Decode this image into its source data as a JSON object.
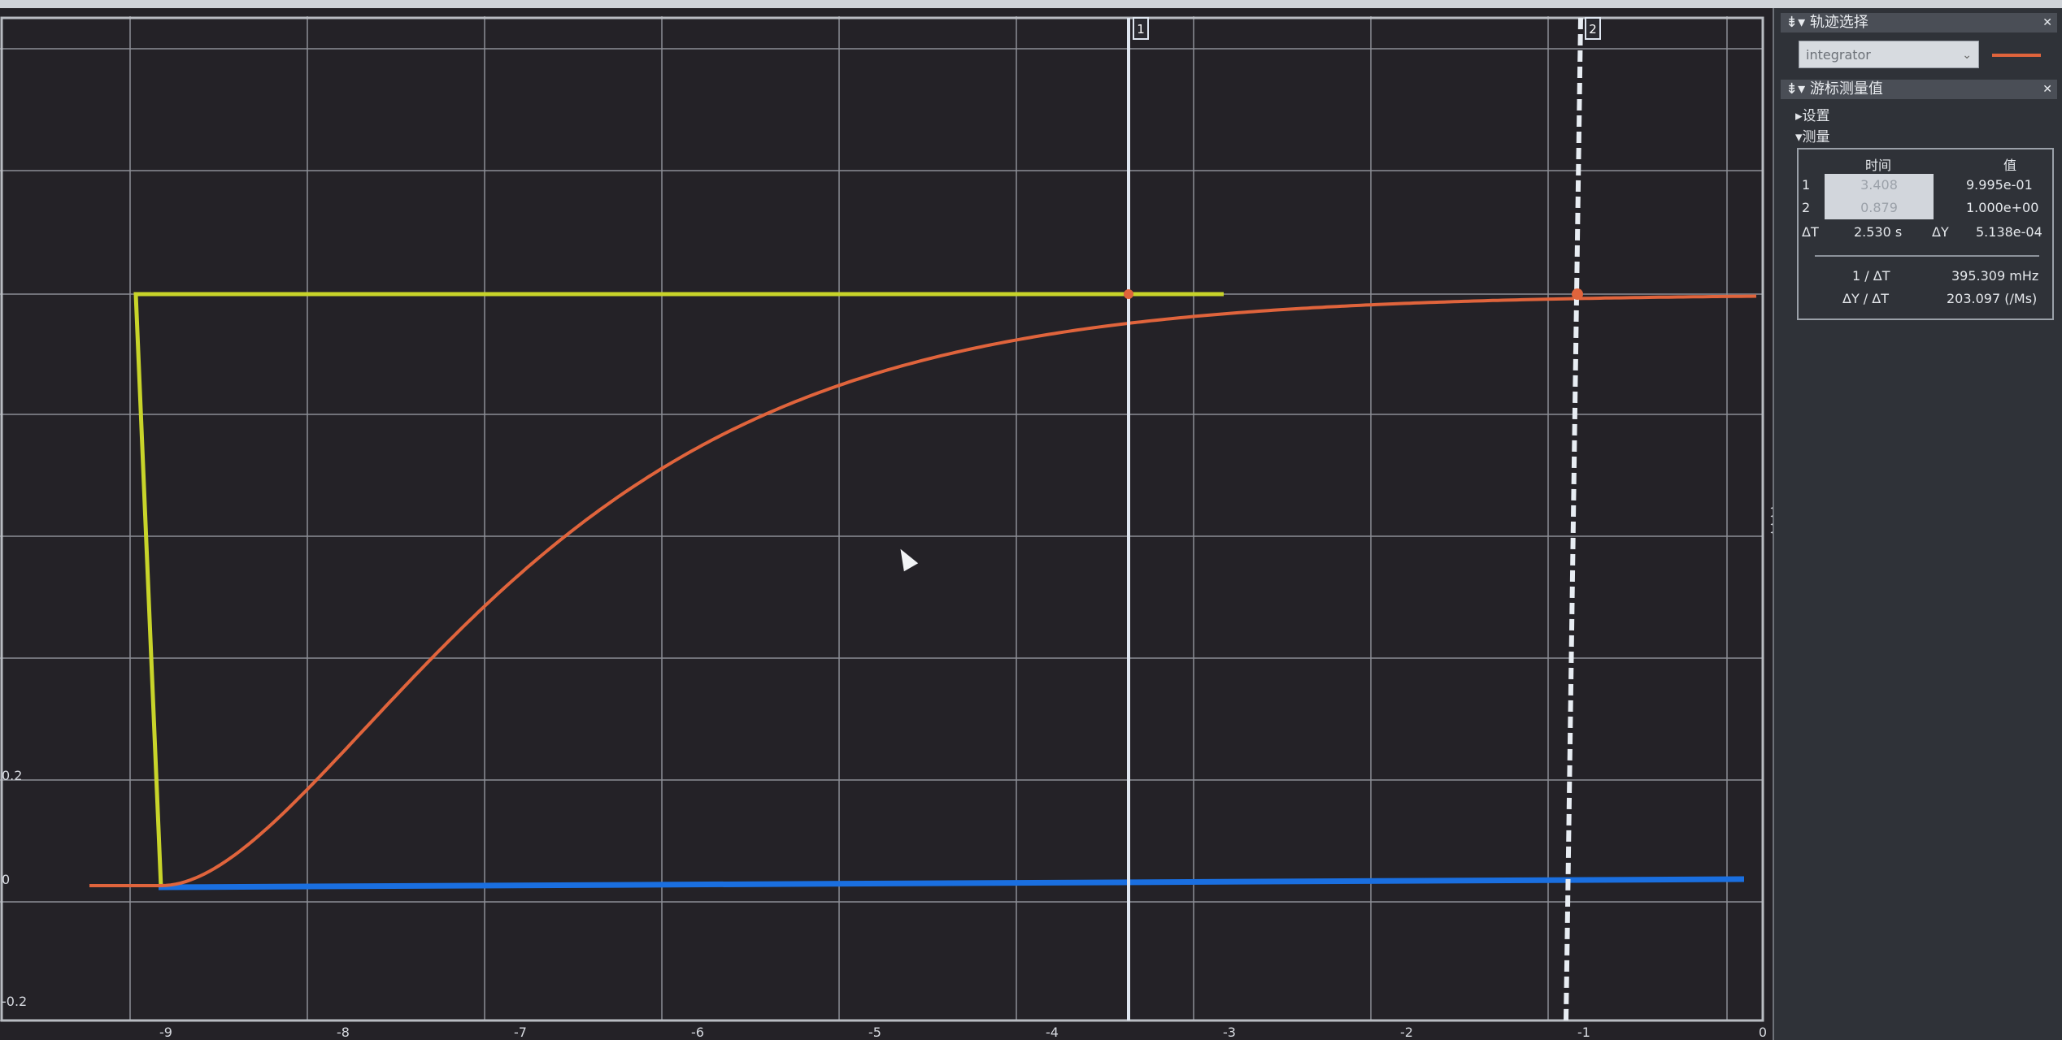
{
  "plot": {
    "y_tick_labels": [
      "0.2",
      "0",
      "-0.2"
    ],
    "x_tick_labels": [
      "-9",
      "-8",
      "-7",
      "-6",
      "-5",
      "-4",
      "-3",
      "-2",
      "-1",
      "0"
    ],
    "cursor1_label": "1",
    "cursor2_label": "2",
    "step_color": "#c8d42a",
    "response_color": "#e0643c",
    "zero_line_color": "#1a6fe0"
  },
  "panel": {
    "trace_selection": {
      "title": "轨迹选择",
      "selected": "integrator",
      "swatch_color": "#e0643c"
    },
    "cursor_measurements": {
      "title": "游标测量值",
      "settings_label": "▸设置",
      "measure_label": "▾测量",
      "col_time": "时间",
      "col_value": "值",
      "row1_index": "1",
      "row1_time": "3.408",
      "row1_value": "9.995e-01",
      "row2_index": "2",
      "row2_time": "0.879",
      "row2_value": "1.000e+00",
      "delta_t_label": "ΔT",
      "delta_t_value": "2.530 s",
      "delta_y_label": "ΔY",
      "delta_y_value": "5.138e-04",
      "inv_dt_label": "1 / ΔT",
      "inv_dt_value": "395.309 mHz",
      "dy_dt_label": "ΔY / ΔT",
      "dy_dt_value": "203.097 (/Ms)"
    }
  }
}
